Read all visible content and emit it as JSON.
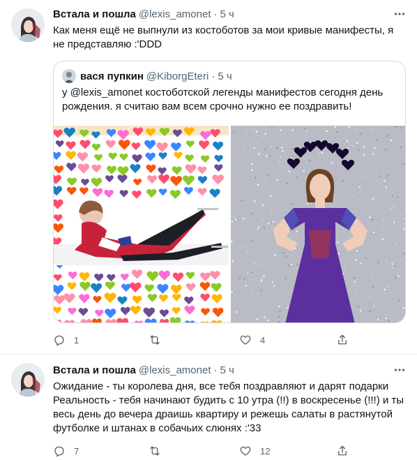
{
  "tweets": [
    {
      "author_name": "Встала и пошла",
      "author_handle": "@lexis_amonet",
      "dot": "·",
      "time": "5 ч",
      "text": "Как меня ещё не выпнули из костоботов за мои кривые манифесты, я не представляю :'DDD",
      "quote": {
        "author_name": "вася пупкин",
        "author_handle": "@KiborgEteri",
        "dot": "·",
        "time": "5 ч",
        "text": "у @lexis_amonet костоботской легенды манифестов сегодня день рождения. я считаю вам всем срочно нужно ее поздравить!"
      },
      "replies": "1",
      "retweets": "",
      "likes": "4"
    },
    {
      "author_name": "Встала и пошла",
      "author_handle": "@lexis_amonet",
      "dot": "·",
      "time": "5 ч",
      "text_lines": [
        "Ожидание - ты королева дня, все тебя поздравляют и дарят подарки",
        "Реальность - тебя начинают будить с 10 утра (!!) в воскресенье (!!!) и ты весь день до вечера драишь квартиру и режешь салаты в растянутой футболке и штанах в собачьих слюнях :'33"
      ],
      "replies": "7",
      "retweets": "",
      "likes": "12"
    }
  ],
  "icons": {
    "more": "more-horizontal-icon",
    "reply": "reply-icon",
    "retweet": "retweet-icon",
    "like": "heart-icon",
    "share": "share-icon"
  },
  "colors": {
    "text": "#0f1419",
    "secondary": "#536471",
    "border": "#cfd9de",
    "divider": "#eff3f4",
    "dress": "#5b2f9e"
  }
}
